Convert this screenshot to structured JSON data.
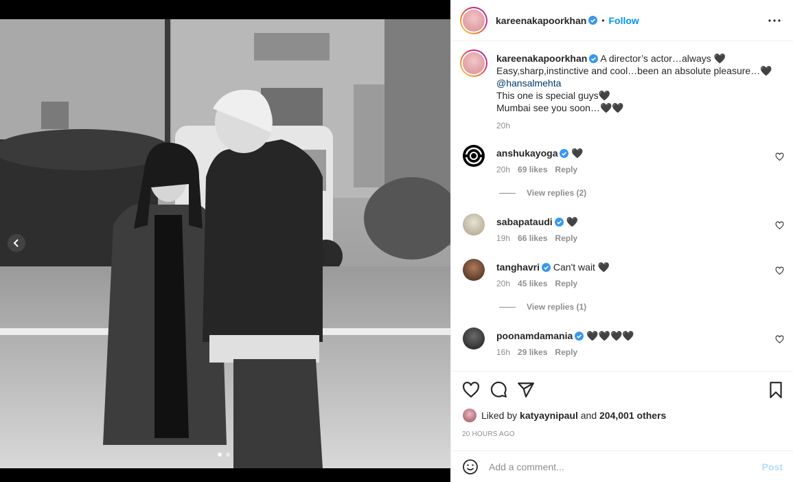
{
  "post": {
    "author": "kareenakapoorkhan",
    "follow_label": "Follow",
    "bullet": "•",
    "caption": {
      "line1": "A director’s actor…always 🖤",
      "line2": "Easy,sharp,instinctive and cool…been an absolute pleasure…🖤",
      "mention": "@hansalmehta",
      "line3": "This one is special guys🖤",
      "line4": "Mumbai see you soon…🖤🖤",
      "time": "20h"
    }
  },
  "comments": [
    {
      "user": "anshukayoga",
      "text": "🖤",
      "time": "20h",
      "likes": "69 likes",
      "reply": "Reply",
      "view_replies": "View replies (2)"
    },
    {
      "user": "sabapataudi",
      "text": "🖤",
      "time": "19h",
      "likes": "66 likes",
      "reply": "Reply"
    },
    {
      "user": "tanghavri",
      "text": "Can't wait 🖤",
      "time": "20h",
      "likes": "45 likes",
      "reply": "Reply",
      "view_replies": "View replies (1)"
    },
    {
      "user": "poonamdamania",
      "text": "🖤🖤🖤🖤",
      "time": "16h",
      "likes": "29 likes",
      "reply": "Reply"
    }
  ],
  "likes": {
    "prefix": "Liked by",
    "user": "katyaynipaul",
    "and": "and",
    "others": "204,001 others"
  },
  "timestamp": "20 HOURS AGO",
  "add_comment": {
    "placeholder": "Add a comment...",
    "post_label": "Post"
  },
  "colors": {
    "accent": "#0095f6",
    "verified": "#3897f0",
    "muted": "#8e8e8e",
    "post_disabled": "#b2dffc"
  },
  "icons": [
    "chevron-left-icon",
    "more-icon",
    "verified-icon",
    "heart-icon",
    "comment-icon",
    "share-icon",
    "bookmark-icon",
    "emoji-icon"
  ]
}
